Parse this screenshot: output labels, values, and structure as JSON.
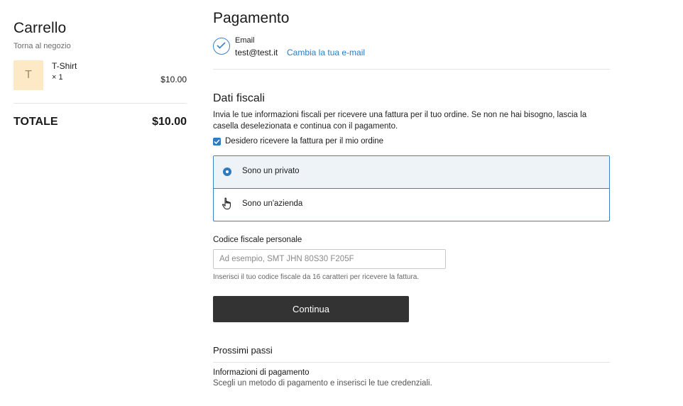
{
  "cart": {
    "title": "Carrello",
    "back_link": "Torna al negozio",
    "items": [
      {
        "thumb_letter": "T",
        "name": "T-Shirt",
        "qty": "× 1",
        "price": "$10.00"
      }
    ],
    "total_label": "TOTALE",
    "total_value": "$10.00"
  },
  "payment": {
    "title": "Pagamento",
    "email_label": "Email",
    "email_value": "test@test.it",
    "change_email": "Cambia la tua e-mail",
    "fiscal_title": "Dati fiscali",
    "fiscal_desc": "Invia le tue informazioni fiscali per ricevere una fattura per il tuo ordine. Se non ne hai bisogno, lascia la casella deselezionata e continua con il pagamento.",
    "invoice_checkbox_label": "Desidero ricevere la fattura per il mio ordine",
    "invoice_checked": true,
    "options": [
      {
        "label": "Sono un privato",
        "selected": true
      },
      {
        "label": "Sono un'azienda",
        "selected": false
      }
    ],
    "cf_label": "Codice fiscale personale",
    "cf_placeholder": "Ad esempio, SMT JHN 80S30 F205F",
    "cf_value": "",
    "cf_help": "Inserisci il tuo codice fiscale da 16 caratteri per ricevere la fattura.",
    "continue_label": "Continua",
    "next_title": "Prossimi passi",
    "next_item_title": "Informazioni di pagamento",
    "next_item_desc": "Scegli un metodo di pagamento e inserisci le tue credenziali."
  },
  "colors": {
    "accent": "#2f7bbf",
    "button_bg": "#333333",
    "thumb_bg": "#fde9c6"
  },
  "icons": {
    "email_status": "check-circle-icon",
    "pointer": "hand-cursor-icon"
  }
}
